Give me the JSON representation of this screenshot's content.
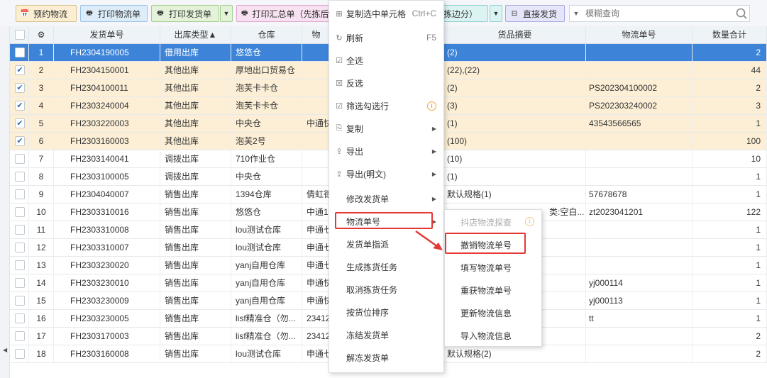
{
  "toolbar": {
    "buttons": [
      {
        "label": "预约物流",
        "icon": "calendar-icon"
      },
      {
        "label": "打印物流单",
        "icon": "printer-icon"
      },
      {
        "label": "打印发货单",
        "icon": "printer-icon"
      },
      {
        "label": "打印汇总单（先拣后分）",
        "icon": "printer-icon"
      },
      {
        "label": "拣边分）",
        "icon": ""
      },
      {
        "label": "直接发货",
        "icon": "ship-icon"
      }
    ],
    "search_placeholder": "模糊查询"
  },
  "columns": {
    "seq": "",
    "gear": "⚙",
    "order_no": "发货单号",
    "type": "出库类型▲",
    "warehouse": "仓库",
    "logistics": "物",
    "goods": "货品摘要",
    "tracking": "物流单号",
    "qty": "数量合计"
  },
  "rows": [
    {
      "n": "1",
      "checked": false,
      "state": "active",
      "order": "FH2304190005",
      "type": "借用出库",
      "wh": "悠悠仓",
      "log": "",
      "goods": "(2)",
      "track": "",
      "qty": "2"
    },
    {
      "n": "2",
      "checked": true,
      "state": "sel",
      "order": "FH2304150001",
      "type": "其他出库",
      "wh": "厚地出口贸易仓",
      "log": "",
      "goods": "(22),(22)",
      "track": "",
      "qty": "44"
    },
    {
      "n": "3",
      "checked": true,
      "state": "sel",
      "order": "FH2304100011",
      "type": "其他出库",
      "wh": "泡芙卡卡仓",
      "log": "",
      "goods": "(2)",
      "track": "PS202304100002",
      "qty": "2"
    },
    {
      "n": "4",
      "checked": true,
      "state": "sel",
      "order": "FH2303240004",
      "type": "其他出库",
      "wh": "泡芙卡卡仓",
      "log": "",
      "goods": "(3)",
      "track": "PS202303240002",
      "qty": "3"
    },
    {
      "n": "5",
      "checked": true,
      "state": "sel",
      "order": "FH2303220003",
      "type": "其他出库",
      "wh": "中央仓",
      "log": "中通快",
      "goods": "(1)",
      "track": "43543566565",
      "qty": "1"
    },
    {
      "n": "6",
      "checked": true,
      "state": "sel",
      "order": "FH2303160003",
      "type": "其他出库",
      "wh": "泡芙2号",
      "log": "",
      "goods": "(100)",
      "track": "",
      "qty": "100"
    },
    {
      "n": "7",
      "checked": false,
      "state": "",
      "order": "FH2303140041",
      "type": "调拨出库",
      "wh": "710作业仓",
      "log": "",
      "goods": "(10)",
      "track": "",
      "qty": "10"
    },
    {
      "n": "8",
      "checked": false,
      "state": "",
      "order": "FH2303100005",
      "type": "调拨出库",
      "wh": "中央仓",
      "log": "",
      "goods": "(1)",
      "track": "",
      "qty": "1"
    },
    {
      "n": "9",
      "checked": false,
      "state": "",
      "order": "FH2304040007",
      "type": "销售出库",
      "wh": "1394仓库",
      "log": "倩虹德",
      "goods": "默认规格(1)",
      "track": "57678678",
      "qty": "1"
    },
    {
      "n": "10",
      "checked": false,
      "state": "",
      "order": "FH2303310016",
      "type": "销售出库",
      "wh": "悠悠仓",
      "log": "中通1",
      "goods": "",
      "goods_tail": "类:空白...",
      "track": "zt2023041201",
      "qty": "122"
    },
    {
      "n": "11",
      "checked": false,
      "state": "",
      "order": "FH2303310008",
      "type": "销售出库",
      "wh": "lou测试仓库",
      "log": "申通七",
      "goods": "",
      "track": "",
      "qty": "1"
    },
    {
      "n": "12",
      "checked": false,
      "state": "",
      "order": "FH2303310007",
      "type": "销售出库",
      "wh": "lou测试仓库",
      "log": "申通七",
      "goods": "",
      "track": "",
      "qty": "1"
    },
    {
      "n": "13",
      "checked": false,
      "state": "",
      "order": "FH2303230020",
      "type": "销售出库",
      "wh": "yanj自用仓库",
      "log": "申通七",
      "goods": "",
      "track": "",
      "qty": "1"
    },
    {
      "n": "14",
      "checked": false,
      "state": "",
      "order": "FH2303230010",
      "type": "销售出库",
      "wh": "yanj自用仓库",
      "log": "申通快",
      "goods": "",
      "track": "yj000114",
      "qty": "1"
    },
    {
      "n": "15",
      "checked": false,
      "state": "",
      "order": "FH2303230009",
      "type": "销售出库",
      "wh": "yanj自用仓库",
      "log": "申通快",
      "goods": "",
      "track": "yj000113",
      "qty": "1"
    },
    {
      "n": "16",
      "checked": false,
      "state": "",
      "order": "FH2303230005",
      "type": "销售出库",
      "wh": "lisf精准仓（勿...",
      "log": "23412",
      "goods": "",
      "track": "tt",
      "qty": "1"
    },
    {
      "n": "17",
      "checked": false,
      "state": "",
      "order": "FH2303170003",
      "type": "销售出库",
      "wh": "lisf精准仓（勿...",
      "log": "23412",
      "goods": "",
      "track": "",
      "qty": "2"
    },
    {
      "n": "18",
      "checked": false,
      "state": "",
      "order": "FH2303160008",
      "type": "销售出库",
      "wh": "lou测试仓库",
      "log": "申通七",
      "goods": "默认规格(2)",
      "track": "",
      "qty": "2"
    }
  ],
  "context_menu": {
    "items": [
      {
        "label": "复制选中单元格",
        "icon": "grid-icon",
        "shortcut": "Ctrl+C"
      },
      {
        "label": "刷新",
        "icon": "refresh-icon",
        "shortcut": "F5"
      },
      {
        "label": "全选",
        "icon": "select-all-icon"
      },
      {
        "label": "反选",
        "icon": "invert-select-icon"
      },
      {
        "label": "筛选勾选行",
        "icon": "filter-check-icon",
        "warn": "i"
      },
      {
        "label": "复制",
        "icon": "copy-icon",
        "sub": "▶"
      },
      {
        "label": "导出",
        "icon": "export-icon",
        "sub": "▶"
      },
      {
        "label": "导出(明文)",
        "icon": "export-icon",
        "sub": "▶"
      },
      {
        "label": "修改发货单",
        "sub": "▶"
      },
      {
        "label": "物流单号",
        "sub": "▶"
      },
      {
        "label": "发货单指派"
      },
      {
        "label": "生成拣货任务"
      },
      {
        "label": "取消拣货任务"
      },
      {
        "label": "按货位排序"
      },
      {
        "label": "冻结发货单"
      },
      {
        "label": "解冻发货单"
      }
    ]
  },
  "submenu": {
    "items": [
      {
        "label": "抖店物流探查",
        "disabled": true,
        "warn": "i"
      },
      {
        "label": "撤销物流单号"
      },
      {
        "label": "填写物流单号"
      },
      {
        "label": "重获物流单号"
      },
      {
        "label": "更新物流信息"
      },
      {
        "label": "导入物流信息"
      }
    ]
  },
  "colors": {
    "active_row": "#3d84d9",
    "selected_row": "#fcefd6",
    "highlight": "#e53935"
  }
}
